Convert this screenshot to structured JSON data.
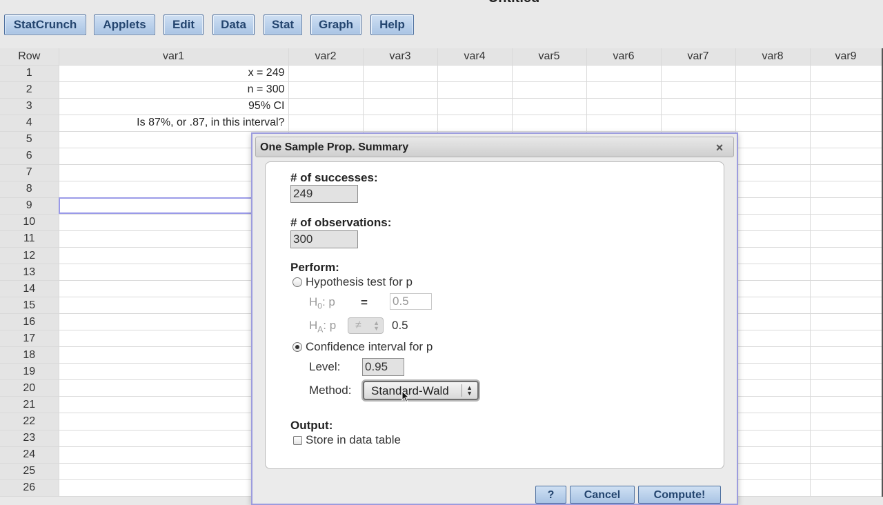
{
  "document": {
    "title": "Untitled"
  },
  "menu": [
    {
      "id": "statcrunch",
      "label": "StatCrunch"
    },
    {
      "id": "applets",
      "label": "Applets"
    },
    {
      "id": "edit",
      "label": "Edit"
    },
    {
      "id": "data",
      "label": "Data"
    },
    {
      "id": "stat",
      "label": "Stat"
    },
    {
      "id": "graph",
      "label": "Graph"
    },
    {
      "id": "help",
      "label": "Help"
    }
  ],
  "grid": {
    "row_header": "Row",
    "columns": [
      "var1",
      "var2",
      "var3",
      "var4",
      "var5",
      "var6",
      "var7",
      "var8",
      "var9"
    ],
    "rows": [
      "1",
      "2",
      "3",
      "4",
      "5",
      "6",
      "7",
      "8",
      "9",
      "10",
      "11",
      "12",
      "13",
      "14",
      "15",
      "16",
      "17",
      "18",
      "19",
      "20",
      "21",
      "22",
      "23",
      "24",
      "25",
      "26"
    ],
    "var1_cells": [
      "x = 249",
      "n = 300",
      "95% CI",
      "Is 87%, or .87, in this interval?"
    ],
    "selected_row": "9"
  },
  "dialog": {
    "title": "One Sample Prop. Summary",
    "successes_label": "# of successes:",
    "successes_value": "249",
    "observations_label": "# of observations:",
    "observations_value": "300",
    "perform_label": "Perform:",
    "hypothesis_label": "Hypothesis test for p",
    "h0_prefix": "H",
    "h0_sub": "0",
    "h0_suffix": ": p",
    "h0_equals": "=",
    "h0_value": "0.5",
    "ha_prefix": "H",
    "ha_sub": "A",
    "ha_suffix": ": p",
    "ha_symbol": "≠",
    "ha_value": "0.5",
    "ci_label": "Confidence interval for p",
    "level_label": "Level:",
    "level_value": "0.95",
    "method_label": "Method:",
    "method_value": "Standard-Wald",
    "output_label": "Output:",
    "store_label": "Store in data table",
    "selected_mode": "confidence-interval",
    "store_checked": false,
    "buttons": {
      "help": "?",
      "cancel": "Cancel",
      "compute": "Compute!"
    }
  }
}
